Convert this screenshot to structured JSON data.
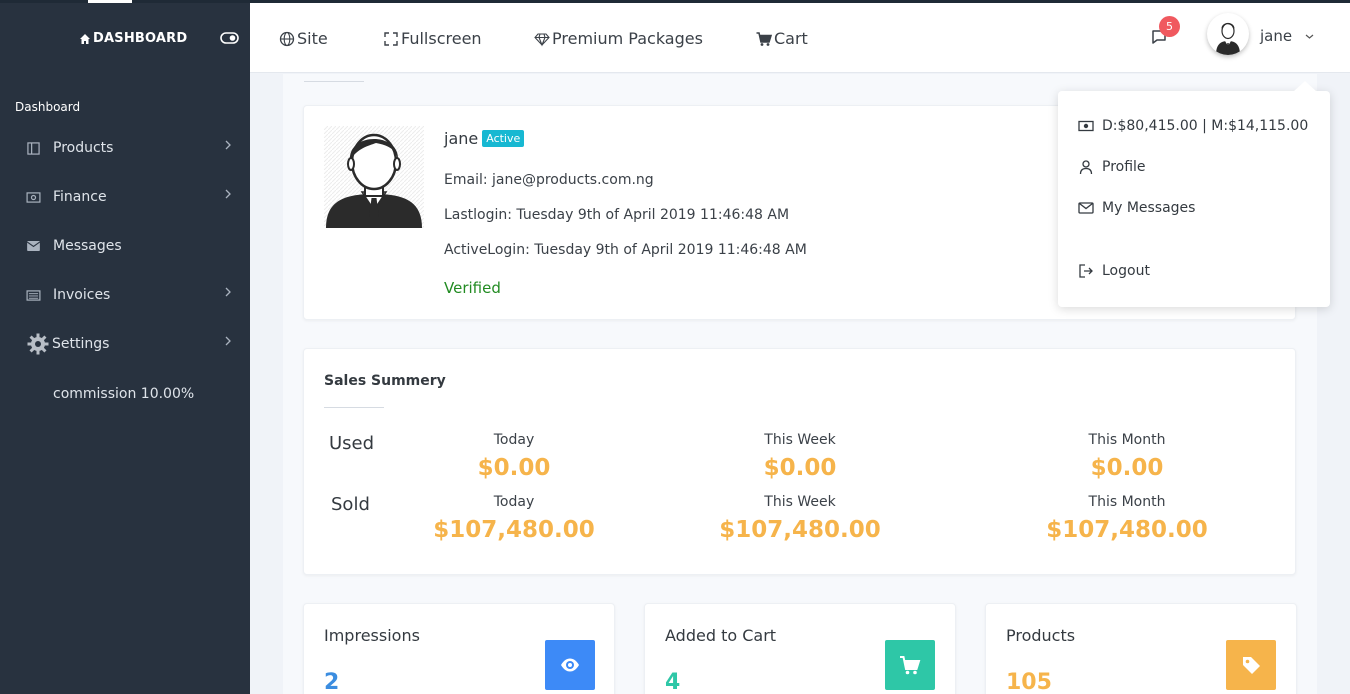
{
  "sidebar": {
    "brand": "DASHBOARD",
    "heading": "Dashboard",
    "items": [
      {
        "label": "Products",
        "icon": "columns-icon"
      },
      {
        "label": "Finance",
        "icon": "money-icon"
      },
      {
        "label": "Messages",
        "icon": "envelope-icon"
      },
      {
        "label": "Invoices",
        "icon": "invoice-icon"
      },
      {
        "label": "Settings",
        "icon": "gear-icon"
      }
    ],
    "commission": "commission 10.00%"
  },
  "header": {
    "nav": [
      {
        "label": "Site",
        "icon": "globe-icon"
      },
      {
        "label": "Fullscreen",
        "icon": "fullscreen-icon"
      },
      {
        "label": "Premium Packages",
        "icon": "diamond-icon"
      },
      {
        "label": "Cart",
        "icon": "cart-icon"
      }
    ],
    "notifications_count": "5",
    "user_name": "jane"
  },
  "profile": {
    "name": "jane",
    "status": "Active",
    "email": "Email: jane@products.com.ng",
    "last_login": "Lastlogin: Tuesday 9th of April 2019 11:46:48 AM",
    "active_login": "ActiveLogin: Tuesday 9th of April 2019 11:46:48 AM",
    "verified": "Verified"
  },
  "sales": {
    "title": "Sales Summery",
    "periods": [
      "Today",
      "This Week",
      "This Month"
    ],
    "used": {
      "label": "Used",
      "values": [
        "$0.00",
        "$0.00",
        "$0.00"
      ]
    },
    "sold": {
      "label": "Sold",
      "values": [
        "$107,480.00",
        "$107,480.00",
        "$107,480.00"
      ]
    }
  },
  "stats": [
    {
      "title": "Impressions",
      "value": "2",
      "color": "#3b8de0",
      "icon": "eye-icon",
      "icon_bg": "#3d8af7"
    },
    {
      "title": "Added to Cart",
      "value": "4",
      "color": "#2ec7a7",
      "icon": "cart-icon",
      "icon_bg": "#2ec7a7"
    },
    {
      "title": "Products",
      "value": "105",
      "color": "#f6b44b",
      "icon": "tag-icon",
      "icon_bg": "#f6b44b"
    }
  ],
  "dropdown": {
    "balance": "D:$80,415.00 | M:$14,115.00",
    "profile": "Profile",
    "messages": "My Messages",
    "logout": "Logout"
  },
  "colors": {
    "sidebar": "#28323f",
    "accent_orange": "#f6b44b",
    "active_badge": "#17b8d2",
    "notification_badge": "#f0595f",
    "verified": "#228b22"
  }
}
